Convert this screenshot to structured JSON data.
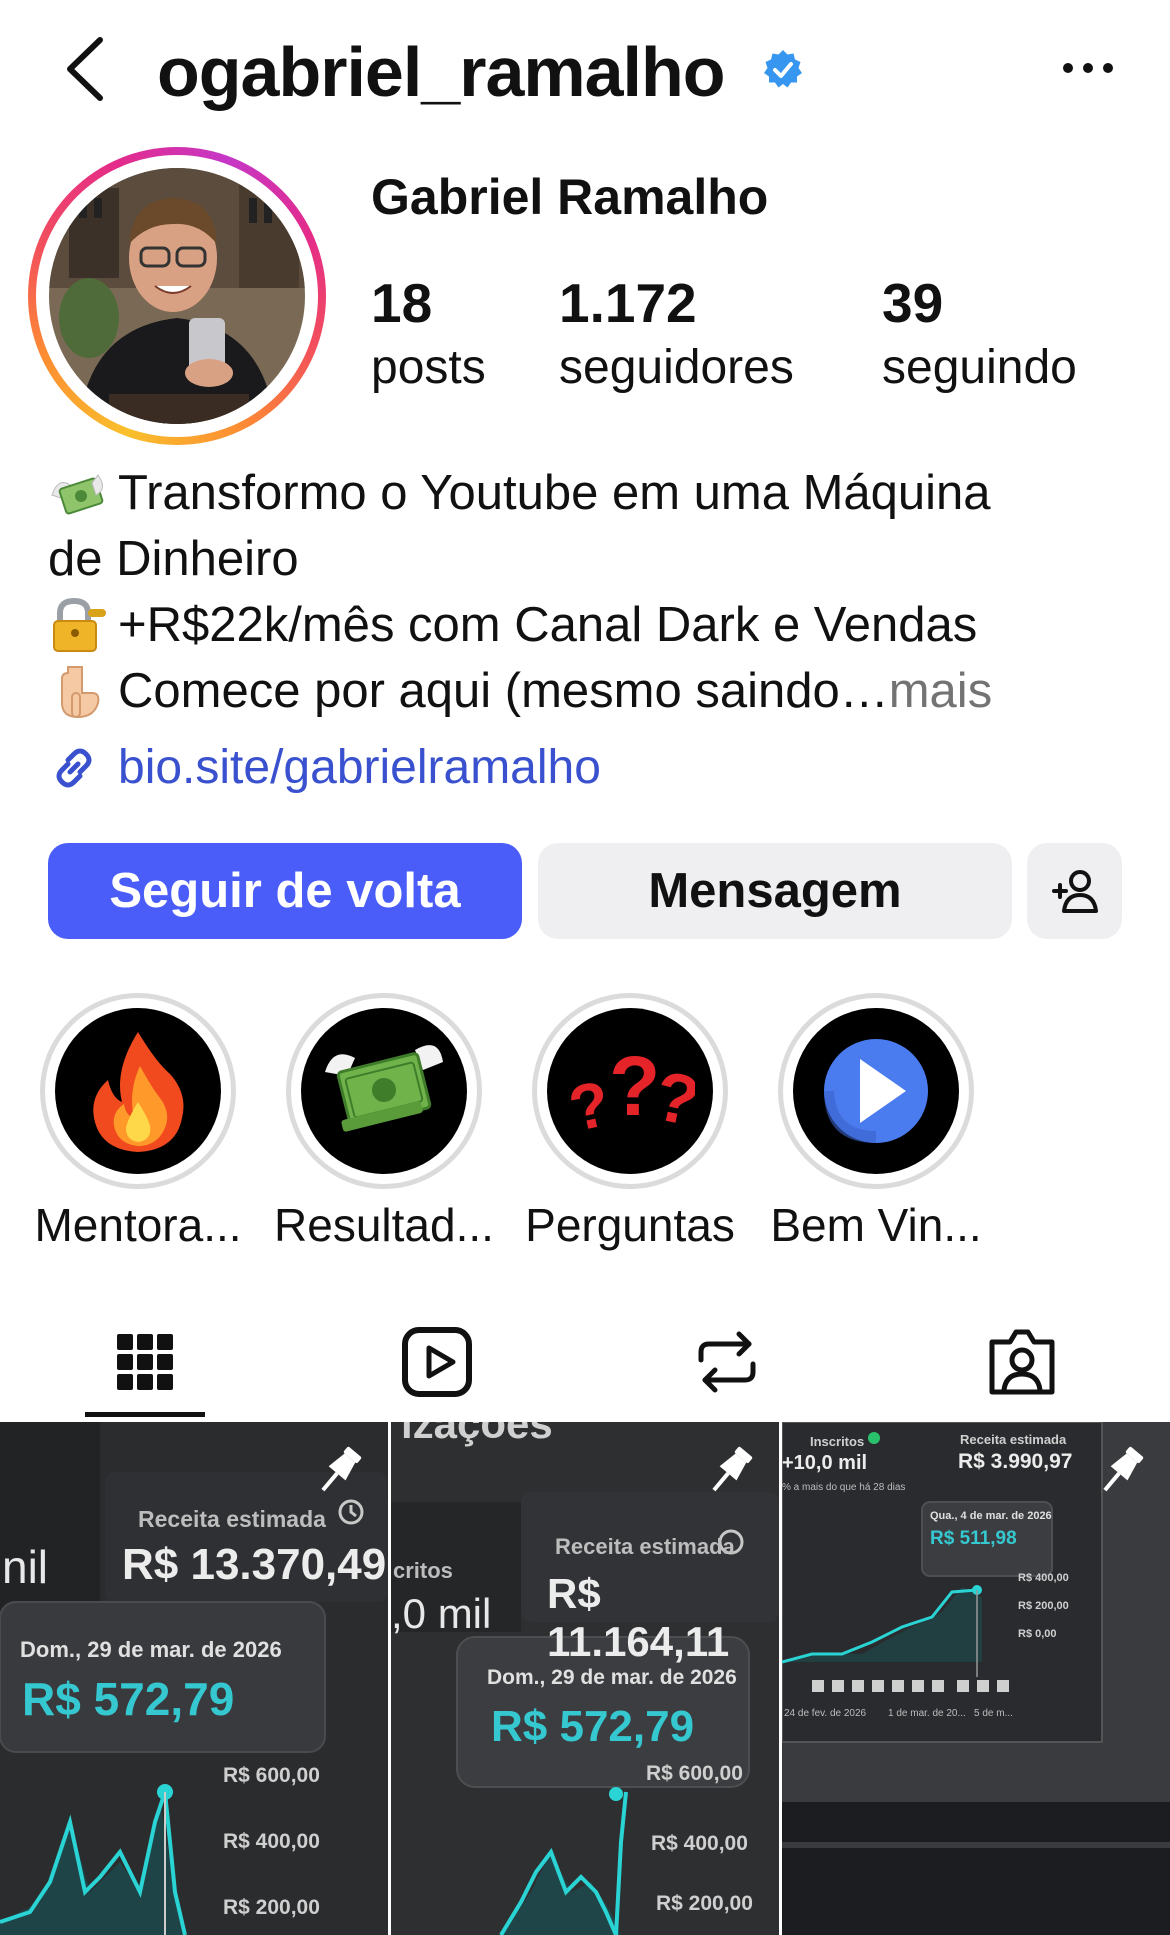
{
  "header": {
    "username": "ogabriel_ramalho"
  },
  "profile": {
    "full_name": "Gabriel Ramalho",
    "stats": [
      {
        "value": "18",
        "label": "posts"
      },
      {
        "value": "1.172",
        "label": "seguidores"
      },
      {
        "value": "39",
        "label": "seguindo"
      }
    ],
    "bio": {
      "line1": "Transformo o Youtube em uma Máquina",
      "line2": "de Dinheiro",
      "line3": "+R$22k/mês com Canal Dark e Vendas",
      "line4": "Comece por aqui (mesmo saindo…",
      "more": " mais"
    },
    "link": "bio.site/gabrielramalho"
  },
  "actions": {
    "follow_back": "Seguir de volta",
    "message": "Mensagem"
  },
  "highlights": [
    {
      "label": "Mentora...",
      "icon": "fire-icon"
    },
    {
      "label": "Resultad...",
      "icon": "flying-money-icon"
    },
    {
      "label": "Perguntas",
      "icon": "question-marks-icon"
    },
    {
      "label": "Bem Vin...",
      "icon": "play-icon"
    }
  ],
  "tabs": [
    "grid-icon",
    "reels-icon",
    "reposts-icon",
    "tagged-icon"
  ],
  "posts": [
    {
      "top_left": "nil",
      "card_title": "Receita estimada",
      "card_value": "R$ 13.370,49",
      "tooltip_date": "Dom., 29 de mar. de 2026",
      "tooltip_value": "R$ 572,79",
      "axis": [
        "R$ 600,00",
        "R$ 400,00",
        "R$ 200,00"
      ]
    },
    {
      "top_text": "izações",
      "top_left1": "critos",
      "top_left2": ",0 mil",
      "card_title": "Receita estimada",
      "card_value": "R$ 11.164,11",
      "tooltip_date": "Dom., 29 de mar. de 2026",
      "tooltip_value": "R$ 572,79",
      "axis": [
        "R$ 600,00",
        "R$ 400,00",
        "R$ 200,00"
      ]
    },
    {
      "inscritos_label": "Inscritos",
      "inscritos_value": "+10,0 mil",
      "inscritos_note": "% a mais do que há 28 dias",
      "card_title": "Receita estimada",
      "card_value": "R$ 3.990,97",
      "tooltip_date": "Qua., 4 de mar. de 2026",
      "tooltip_value": "R$ 511,98",
      "axis": [
        "R$ 400,00",
        "R$ 200,00",
        "R$ 0,00"
      ],
      "x_labels": [
        "24 de fev. de 2026",
        "1 de mar. de 20...",
        "5 de m..."
      ]
    }
  ]
}
